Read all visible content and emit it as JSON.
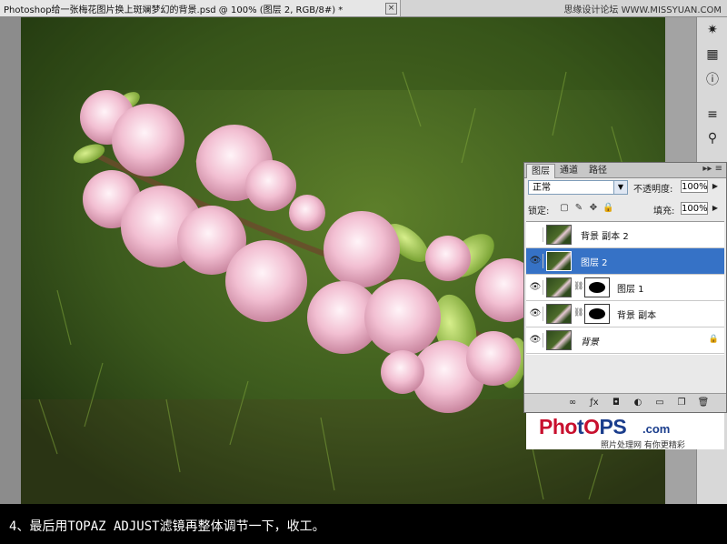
{
  "document": {
    "tab_title": "Photoshop给一张梅花图片换上斑斓梦幻的背景.psd @ 100% (图层 2, RGB/8#) *",
    "close_glyph": "×"
  },
  "watermark": "思缘设计论坛 WWW.MISSYUAN.COM",
  "layers_panel": {
    "tabs": [
      "图层",
      "通道",
      "路径"
    ],
    "menu_glyph": "▸▸ ≡",
    "blend_mode": "正常",
    "opacity_label": "不透明度:",
    "opacity_value": "100%",
    "lock_label": "锁定:",
    "fill_label": "填充:",
    "fill_value": "100%",
    "layers": [
      {
        "name": "背景 副本 2",
        "visible": false,
        "selected": false,
        "has_mask": false
      },
      {
        "name": "图层 2",
        "visible": true,
        "selected": true,
        "has_mask": false
      },
      {
        "name": "图层 1",
        "visible": true,
        "selected": false,
        "has_mask": true
      },
      {
        "name": "背景 副本",
        "visible": true,
        "selected": false,
        "has_mask": true
      },
      {
        "name": "背景",
        "visible": true,
        "selected": false,
        "has_mask": false,
        "locked": true
      }
    ],
    "brand_ph": "Pho",
    "brand_t": "t",
    "brand_o": "O",
    "brand_ps": "PS",
    "brand_com": ".com",
    "brand_sub": "照片处理网 有你更精彩"
  },
  "colors": {
    "selection": "#3672c6",
    "brand_red": "#c8102e",
    "brand_blue": "#1a3d8c"
  },
  "caption": "4、最后用TOPAZ ADJUST滤镜再整体调节一下，收工。"
}
